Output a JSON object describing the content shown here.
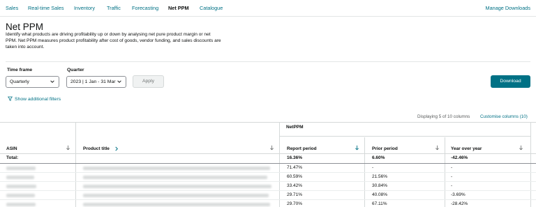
{
  "nav": {
    "tabs": [
      {
        "label": "Sales",
        "active": false
      },
      {
        "label": "Real-time Sales",
        "active": false
      },
      {
        "label": "Inventory",
        "active": false
      },
      {
        "label": "Traffic",
        "active": false
      },
      {
        "label": "Forecasting",
        "active": false
      },
      {
        "label": "Net PPM",
        "active": true
      },
      {
        "label": "Catalogue",
        "active": false
      }
    ],
    "manage_downloads": "Manage Downloads"
  },
  "page": {
    "title": "Net PPM",
    "description": "Identify what products are driving profitability up or down by analysing net pure product margin or net PPM. Net PPM measures product profitability after cost of goods, vendor funding, and sales discounts are taken into account."
  },
  "controls": {
    "time_frame_label": "Time frame",
    "time_frame_value": "Quarterly",
    "quarter_label": "Quarter",
    "quarter_value": "2023 | 1 Jan - 31 Mar",
    "apply_label": "Apply",
    "download_label": "Download",
    "filters_label": "Show additional filters"
  },
  "table_meta": {
    "displaying": "Displaying 5 of 10 columns",
    "customise": "Customise columns (10)",
    "group_header": "NetPPM"
  },
  "columns": {
    "asin": "ASIN",
    "product_title": "Product title",
    "report_period": "Report period",
    "prior_period": "Prior period",
    "yoy": "Year over year"
  },
  "total": {
    "label": "Total:",
    "report_period": "16.36%",
    "prior_period": "6.60%",
    "yoy": "-42.46%"
  },
  "rows": [
    {
      "report_period": "71.47%",
      "prior_period": "-",
      "yoy": "-"
    },
    {
      "report_period": "60.59%",
      "prior_period": "21.56%",
      "yoy": "-"
    },
    {
      "report_period": "33.42%",
      "prior_period": "30.84%",
      "yoy": "-"
    },
    {
      "report_period": "29.71%",
      "prior_period": "40.08%",
      "yoy": "-3.69%"
    },
    {
      "report_period": "29.70%",
      "prior_period": "67.11%",
      "yoy": "-28.42%"
    }
  ],
  "colors": {
    "accent": "#007185",
    "text": "#0f1111",
    "border": "#d5d9d9"
  },
  "icons": {
    "sort": "arrow-down-icon",
    "filter": "funnel-icon",
    "select": "chevron-down-icon",
    "expand": "chevron-right-icon"
  }
}
